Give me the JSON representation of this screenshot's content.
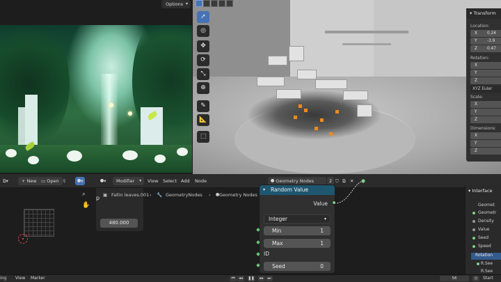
{
  "viewer": {
    "options_label": "Options"
  },
  "npanel": {
    "header": "Transform",
    "location_label": "Location:",
    "location": {
      "x_label": "X",
      "x": "0.24",
      "y_label": "Y",
      "y": "-3.9",
      "z_label": "Z",
      "z": "0.47"
    },
    "rotation_label": "Rotation:",
    "rotation": {
      "x_label": "X",
      "y_label": "Y",
      "z_label": "Z"
    },
    "mode": "XYZ Euler",
    "scale_label": "Scale:",
    "scale": {
      "x_label": "X",
      "y_label": "Y",
      "z_label": "Z"
    },
    "dimensions_label": "Dimensions:",
    "dimensions": {
      "x_label": "X",
      "y_label": "Y",
      "z_label": "Z"
    }
  },
  "node_header": {
    "new_label": "New",
    "open_label": "Open",
    "modifier_label": "Modifier",
    "view_label": "View",
    "select_label": "Select",
    "add_label": "Add",
    "node_label": "Node",
    "tree_name": "Geometry Nodes",
    "user_count": "2"
  },
  "breadcrumb": {
    "object": "Fallin leaves.001",
    "modifier": "GeometryNodes",
    "tree": "Geometry Nodes"
  },
  "modifier_panel": {
    "letter": "p",
    "value": "480.000"
  },
  "node": {
    "title": "Random Value",
    "output_label": "Value",
    "data_type": "Integer",
    "min_label": "Min",
    "min": "1",
    "max_label": "Max",
    "max": "1",
    "id_label": "ID",
    "seed_label": "Seed",
    "seed": "0"
  },
  "interface_panel": {
    "header": "Interface",
    "items": [
      "Geomet",
      "Geometr",
      "Density",
      "Value",
      "Seed",
      "Speed",
      "Rotation",
      "R.See",
      "R.See"
    ]
  },
  "timeline": {
    "playing_label": "ing",
    "view_label": "View",
    "marker_label": "Marker",
    "current_frame": "56",
    "start_label": "Start"
  },
  "colors": {
    "accent": "#4772b3",
    "node_header": "#1f5670",
    "socket_green": "#7fd08a",
    "selection_orange": "#f08a1e"
  }
}
